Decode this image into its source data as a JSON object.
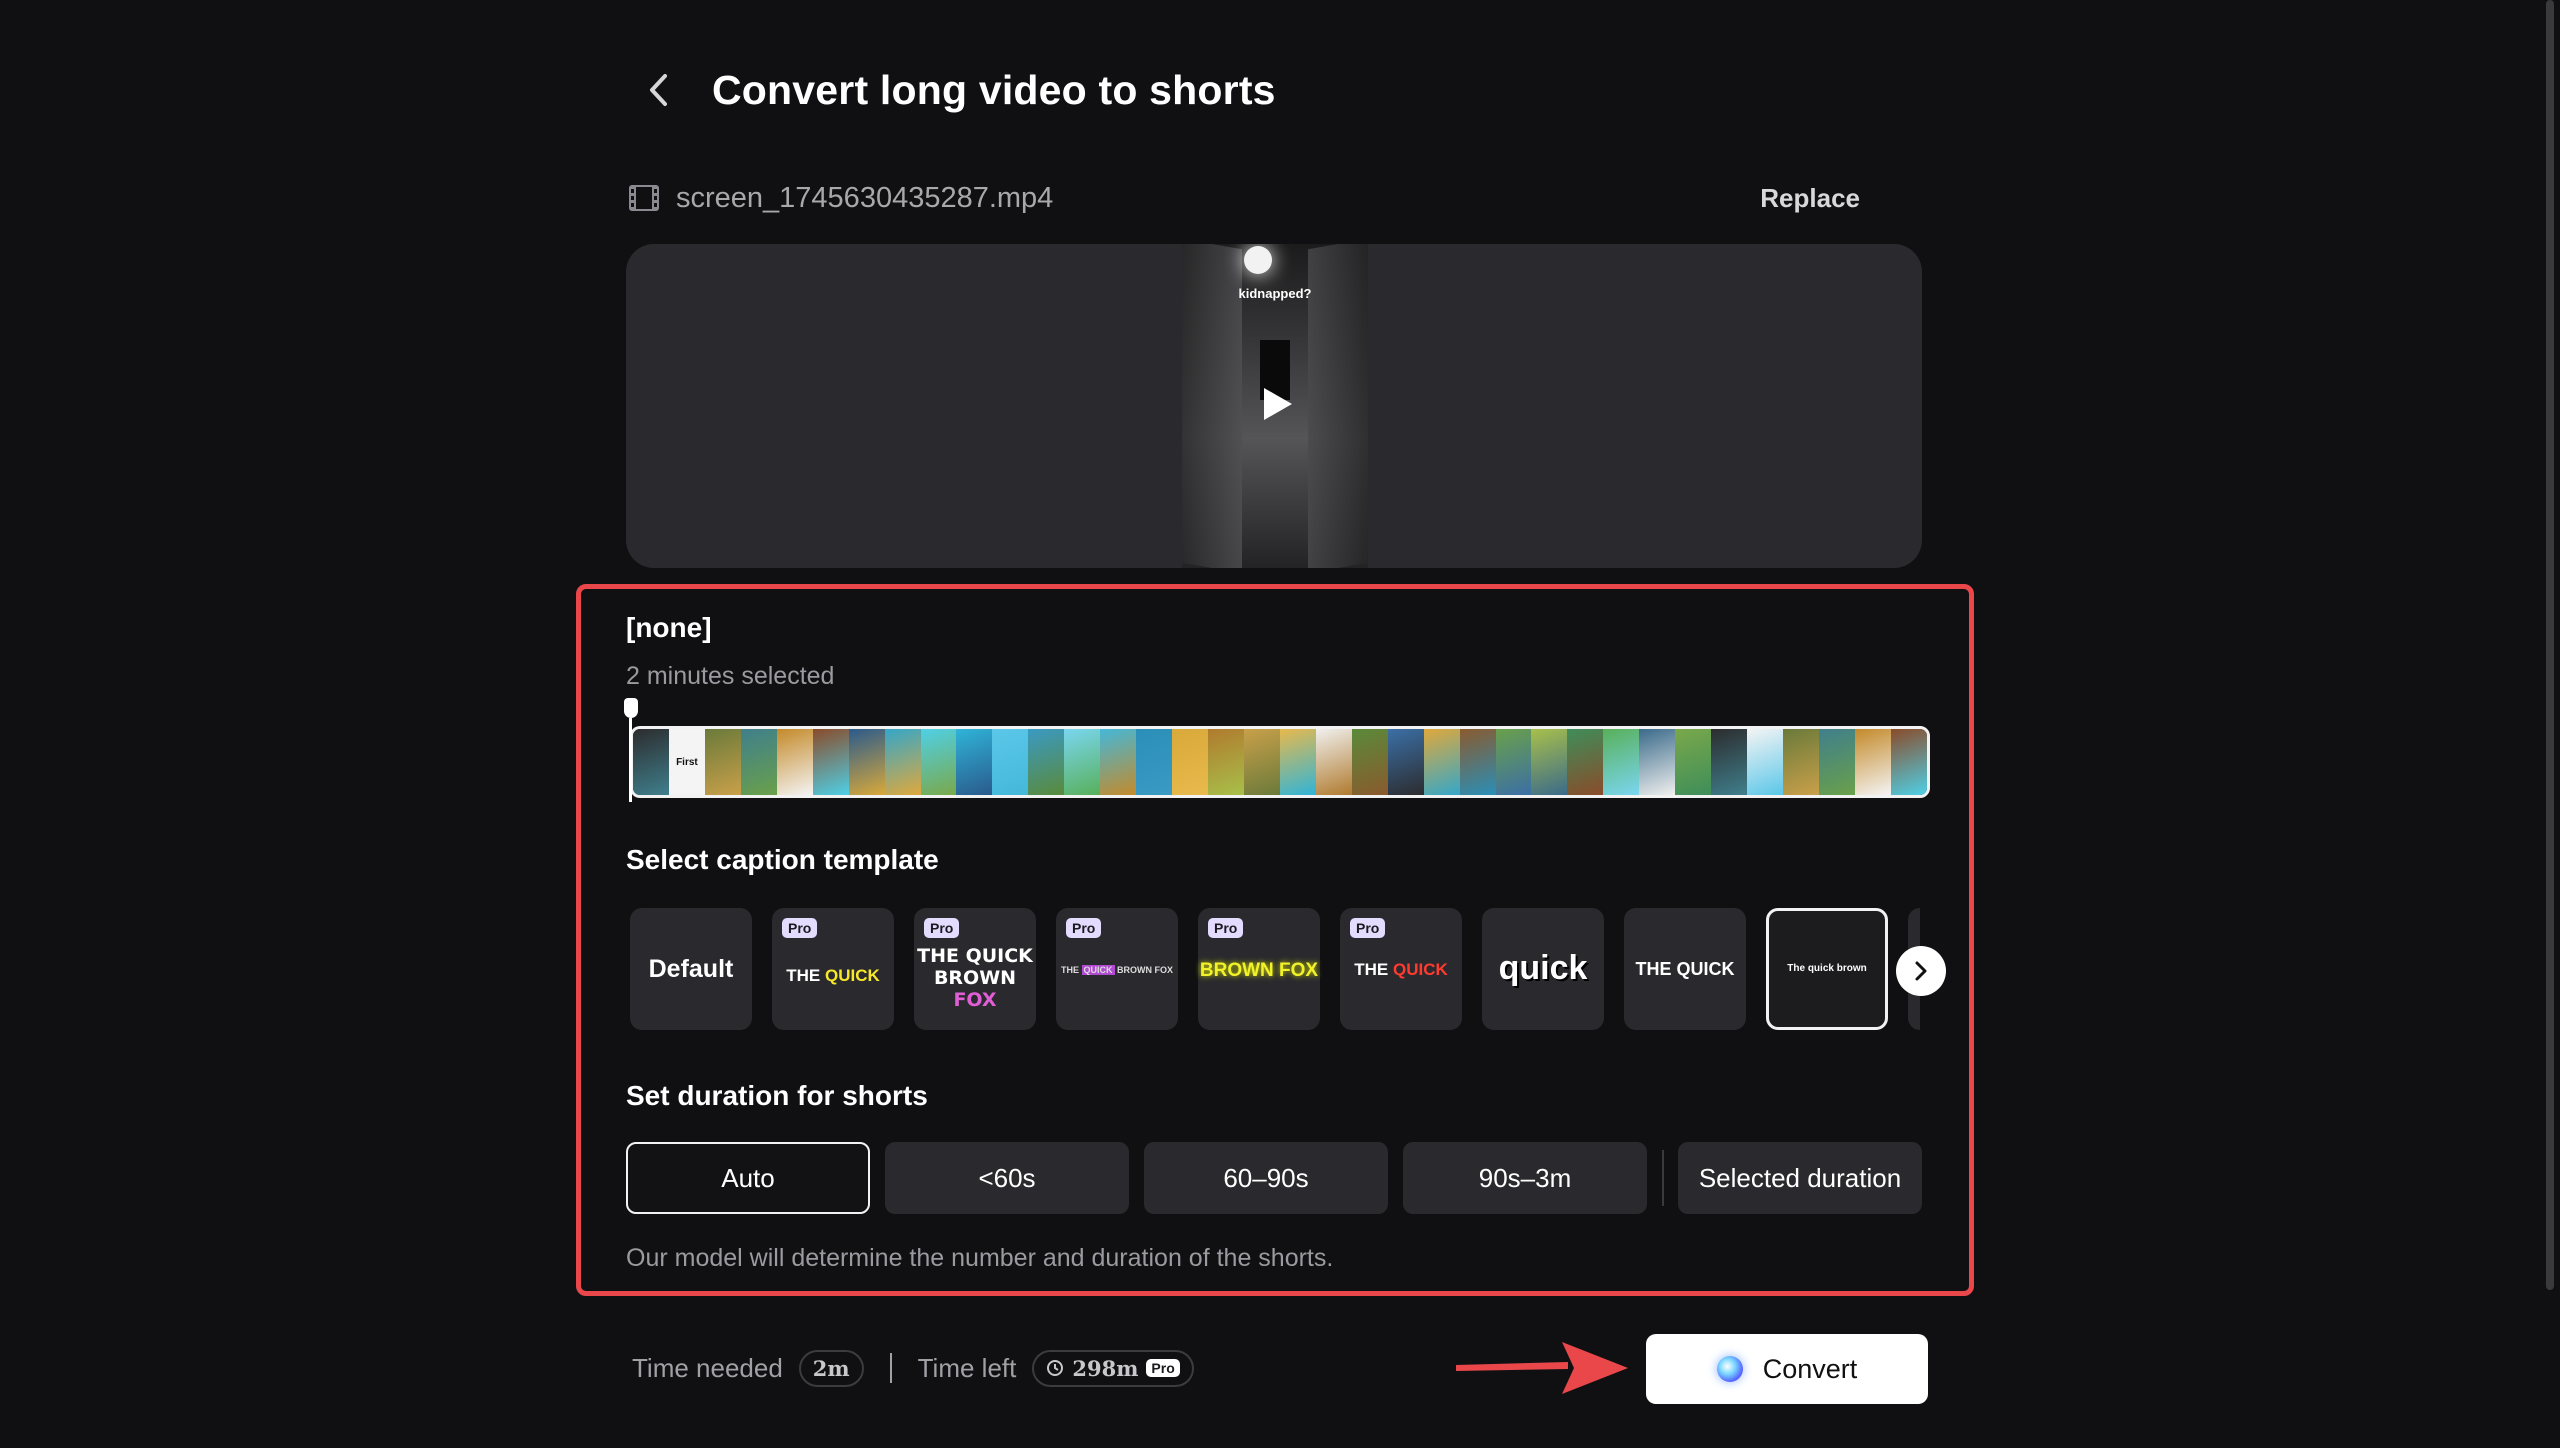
{
  "header": {
    "title": "Convert long video to shorts"
  },
  "file": {
    "name": "screen_1745630435287.mp4",
    "replace_label": "Replace"
  },
  "preview": {
    "overlay_text": "kidnapped?"
  },
  "clip": {
    "title": "[none]",
    "subtitle": "2 minutes selected",
    "timeline_first_frame_text": "First"
  },
  "captions": {
    "heading": "Select caption template",
    "pro_label": "Pro",
    "templates": [
      {
        "text": "Default",
        "pro": false
      },
      {
        "text": "THE QUICK",
        "pro": true
      },
      {
        "text": "THE QUICK BROWN FOX",
        "pro": true
      },
      {
        "text": "THE QUICK BROWN FOX",
        "pro": true
      },
      {
        "text": "BROWN FOX",
        "pro": true
      },
      {
        "text": "THE QUICK",
        "pro": true
      },
      {
        "text": "quick",
        "pro": false
      },
      {
        "text": "THE QUICK",
        "pro": false
      },
      {
        "text": "The quick brown",
        "pro": false,
        "selected": true
      }
    ]
  },
  "duration": {
    "heading": "Set duration for shorts",
    "options": [
      "Auto",
      "<60s",
      "60–90s",
      "90s–3m"
    ],
    "selected_option": "Selected duration",
    "hint": "Our model will determine the number and duration of the shorts."
  },
  "footer": {
    "time_needed_label": "Time needed",
    "time_needed_value": "2m",
    "time_left_label": "Time left",
    "time_left_value": "298m",
    "pro_badge": "Pro",
    "convert_label": "Convert"
  },
  "colors": {
    "annotation_red": "#e9474a",
    "accent_pro": "#e4dcff"
  }
}
